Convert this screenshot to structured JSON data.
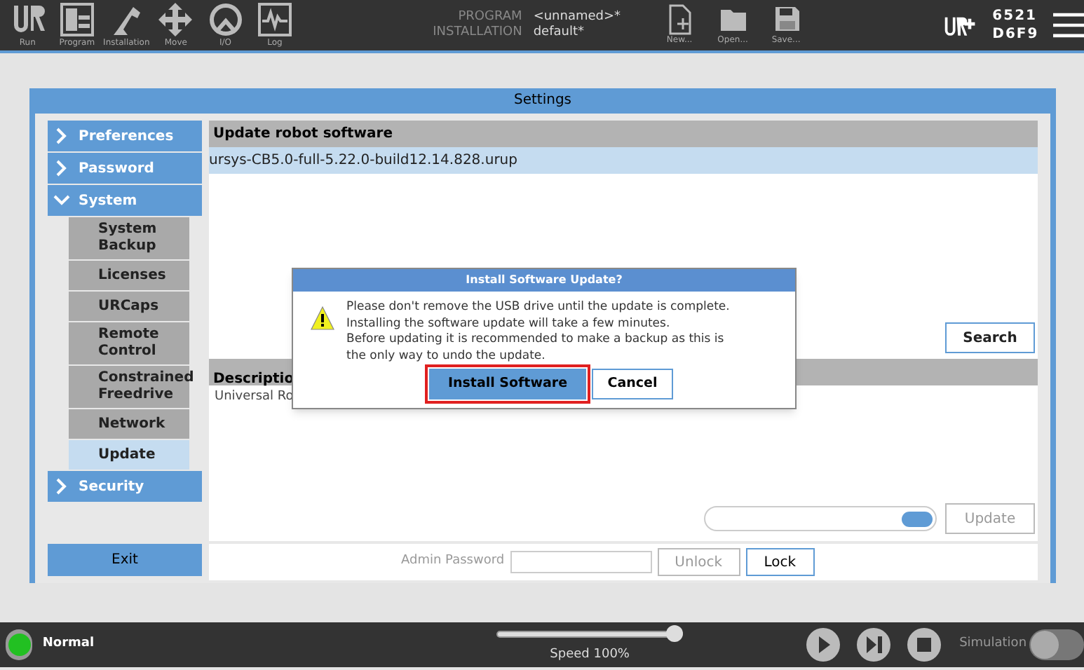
{
  "toolbar": {
    "tabs": [
      {
        "label": "Run",
        "selected": false
      },
      {
        "label": "Program",
        "selected": false
      },
      {
        "label": "Installation",
        "selected": false
      },
      {
        "label": "Move",
        "selected": false
      },
      {
        "label": "I/O",
        "selected": false
      },
      {
        "label": "Log",
        "selected": false
      }
    ],
    "program_label": "PROGRAM",
    "program_value": "<unnamed>*",
    "installation_label": "INSTALLATION",
    "installation_value": "default*",
    "file_buttons": [
      "New...",
      "Open...",
      "Save..."
    ],
    "serial": [
      "6521",
      "D6F9"
    ]
  },
  "settings": {
    "title": "Settings",
    "sidebar": [
      {
        "label": "Preferences",
        "expanded": false
      },
      {
        "label": "Password",
        "expanded": false
      },
      {
        "label": "System",
        "expanded": true,
        "children": [
          {
            "label": "System Backup",
            "selected": false
          },
          {
            "label": "Licenses",
            "selected": false
          },
          {
            "label": "URCaps",
            "selected": false
          },
          {
            "label": "Remote Control",
            "selected": false
          },
          {
            "label": "Constrained Freedrive",
            "selected": false
          },
          {
            "label": "Network",
            "selected": false
          },
          {
            "label": "Update",
            "selected": true
          }
        ]
      },
      {
        "label": "Security",
        "expanded": false
      }
    ],
    "exit_button": "Exit",
    "update_header": "Update robot software",
    "files": [
      {
        "name": "ursys-CB5.0-full-5.22.0-build12.14.828.urup",
        "selected": true
      }
    ],
    "search_button": "Search",
    "description_header": "Descriptio",
    "description_text": "Universal Ro",
    "progress": {
      "level": 1
    },
    "update_button": "Update",
    "password_label": "Admin Password",
    "unlock_button": "Unlock",
    "lock_button": "Lock"
  },
  "dialog": {
    "title": "Install Software Update?",
    "message": [
      "Please don't remove the USB drive until the update is complete.",
      "Installing the software update will take a few minutes.",
      "Before updating it is recommended to make a backup as this is",
      "the only way to undo the update."
    ],
    "buttons": [
      {
        "label": "Install Software",
        "selected": true
      },
      {
        "label": "Cancel",
        "selected": false
      }
    ]
  },
  "status_bar": {
    "status": "Normal",
    "ok": true,
    "speed": {
      "level": 1,
      "label": "Speed 100%"
    },
    "simulation_label": "Simulation",
    "simulation_on": false
  }
}
